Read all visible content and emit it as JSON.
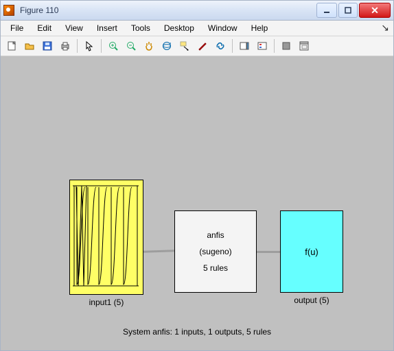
{
  "window": {
    "title": "Figure 110"
  },
  "menu": {
    "file": "File",
    "edit": "Edit",
    "view": "View",
    "insert": "Insert",
    "tools": "Tools",
    "desktop": "Desktop",
    "window": "Window",
    "help": "Help"
  },
  "diagram": {
    "center": {
      "line1": "anfis",
      "line2": "(sugeno)",
      "line3": "5 rules"
    },
    "output_text": "f(u)",
    "input_label": "input1 (5)",
    "output_label": "output (5)",
    "caption": "System anfis: 1 inputs, 1 outputs, 5 rules"
  },
  "chart_data": {
    "type": "diagram",
    "title": "System anfis: 1 inputs, 1 outputs, 5 rules",
    "system_name": "anfis",
    "fis_type": "sugeno",
    "num_rules": 5,
    "inputs": [
      {
        "name": "input1",
        "num_mfs": 5
      }
    ],
    "outputs": [
      {
        "name": "output",
        "num_mfs": 5,
        "expression": "f(u)"
      }
    ]
  }
}
